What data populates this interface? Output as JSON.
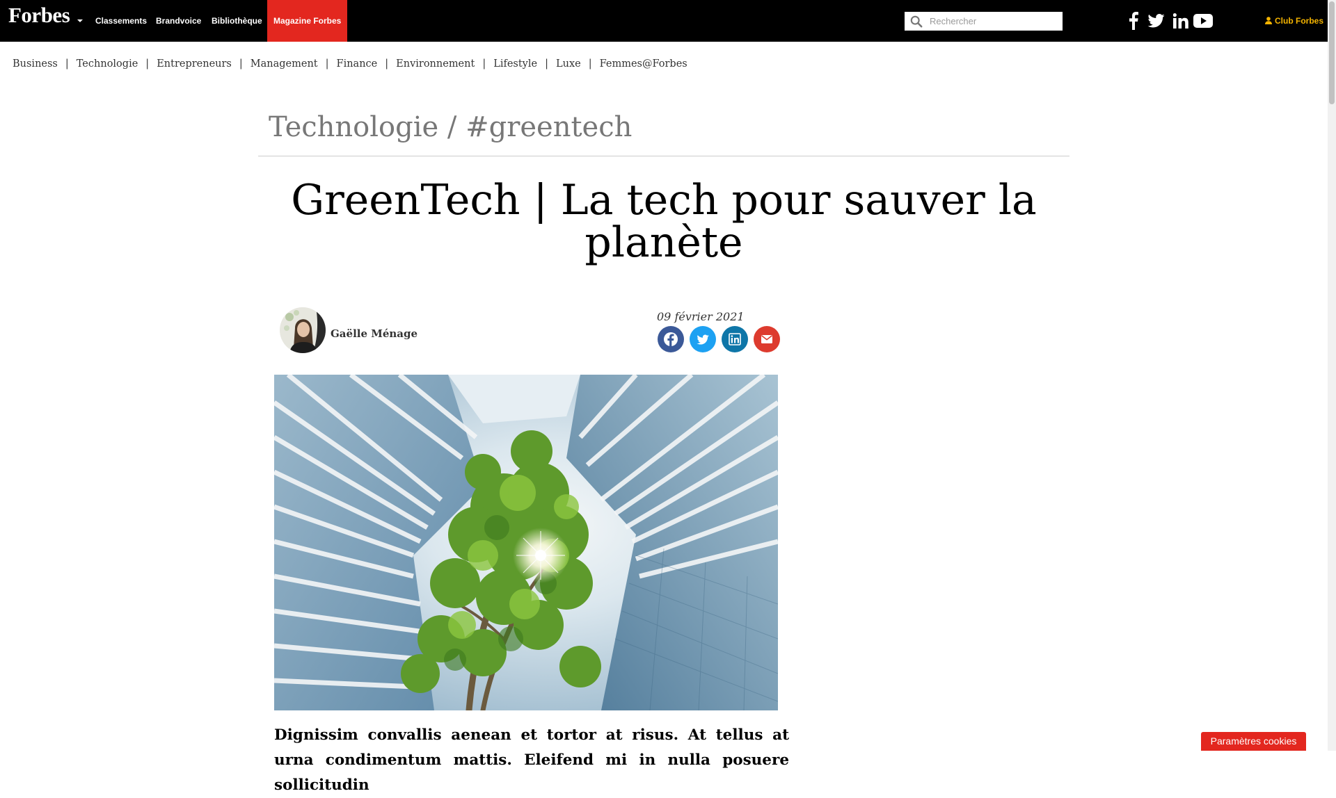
{
  "header": {
    "logo": "Forbes",
    "nav": [
      "Classements",
      "Brandvoice",
      "Bibliothèque",
      "Magazine Forbes"
    ],
    "search_placeholder": "Rechercher",
    "social_icons": [
      "facebook-icon",
      "twitter-icon",
      "linkedin-icon",
      "youtube-icon"
    ],
    "club_label": "Club Forbes",
    "active_color": "#e3271f",
    "club_color": "#f5b400"
  },
  "categories": [
    "Business",
    "Technologie",
    "Entrepreneurs",
    "Management",
    "Finance",
    "Environnement",
    "Lifestyle",
    "Luxe",
    "Femmes@Forbes"
  ],
  "article": {
    "breadcrumb": "Technologie / #greentech",
    "title": "GreenTech | La tech pour sauver la planète",
    "author": "Gaëlle Ménage",
    "date": "09 février 2021",
    "share": [
      {
        "icon": "facebook-icon",
        "color": "#3b5998"
      },
      {
        "icon": "twitter-icon",
        "color": "#1da1f2"
      },
      {
        "icon": "linkedin-icon",
        "color": "#0e76a8"
      },
      {
        "icon": "email-icon",
        "color": "#dd3b2e"
      }
    ],
    "lead": "Dignissim convallis aenean et tortor at risus. At tellus at urna condimentum mattis. Eleifend mi in nulla posuere sollicitudin"
  },
  "cookie_button": "Paramètres cookies"
}
